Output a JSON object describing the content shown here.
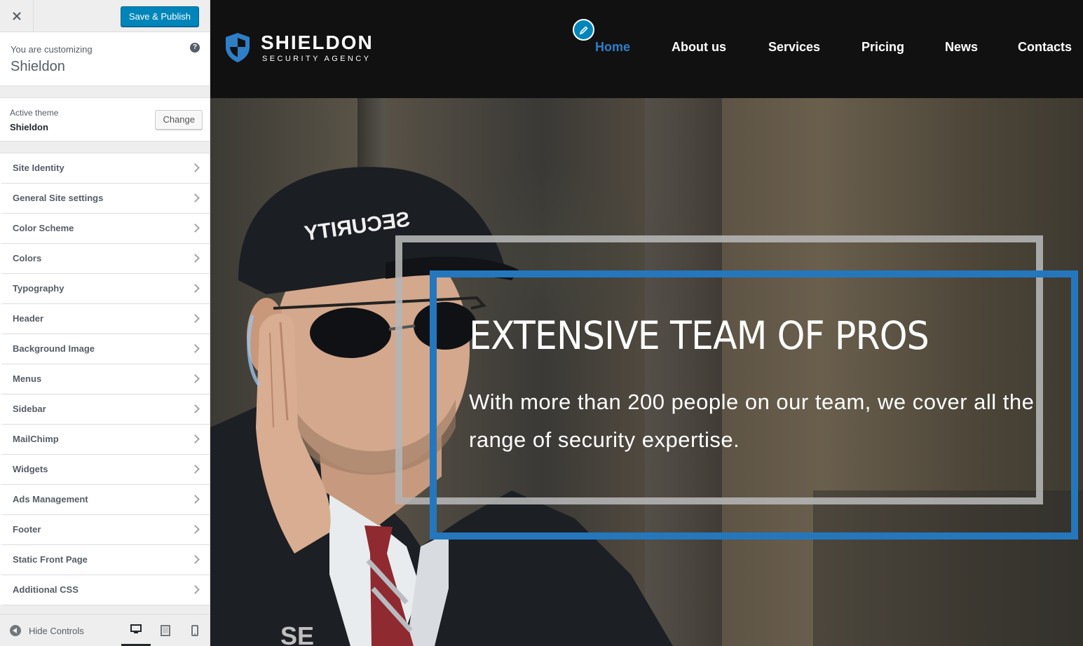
{
  "customizer": {
    "save_label": "Save & Publish",
    "close_icon": "close-icon",
    "customizing_label": "You are customizing",
    "site_name": "Shieldon",
    "help_icon": "?",
    "active_theme_label": "Active theme",
    "active_theme_name": "Shieldon",
    "change_label": "Change",
    "panels": [
      {
        "label": "Site Identity"
      },
      {
        "label": "General Site settings"
      },
      {
        "label": "Color Scheme"
      },
      {
        "label": "Colors"
      },
      {
        "label": "Typography"
      },
      {
        "label": "Header"
      },
      {
        "label": "Background Image"
      },
      {
        "label": "Menus"
      },
      {
        "label": "Sidebar"
      },
      {
        "label": "MailChimp"
      },
      {
        "label": "Widgets"
      },
      {
        "label": "Ads Management"
      },
      {
        "label": "Footer"
      },
      {
        "label": "Static Front Page"
      },
      {
        "label": "Additional CSS"
      }
    ],
    "hide_controls_label": "Hide Controls",
    "devices": [
      "desktop",
      "tablet",
      "mobile"
    ],
    "selected_device": "desktop"
  },
  "site": {
    "logo_name": "SHIELDON",
    "logo_tagline": "SECURITY AGENCY",
    "nav": [
      {
        "label": "Home",
        "active": true
      },
      {
        "label": "About us",
        "active": false
      },
      {
        "label": "Services",
        "active": false
      },
      {
        "label": "Pricing",
        "active": false
      },
      {
        "label": "News",
        "active": false
      },
      {
        "label": "Contacts",
        "active": false
      }
    ],
    "hero": {
      "title": "EXTENSIVE TEAM OF PROS",
      "text": "With more than 200 people on our team, we cover all the range of security expertise."
    }
  },
  "colors": {
    "primary_button": "#0085ba",
    "brand_blue": "#2577bd",
    "nav_active": "#2e7fc7",
    "header_bg": "#111111"
  }
}
